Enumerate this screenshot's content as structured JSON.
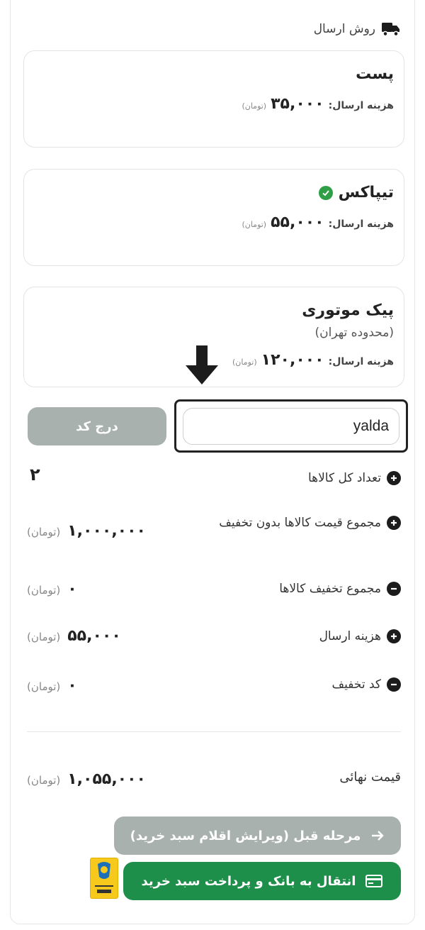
{
  "header": {
    "title": "روش ارسال",
    "icon": "truck-icon"
  },
  "shipping_options": [
    {
      "title": "پست",
      "cost_label": "هزینه ارسال:",
      "cost": "۳۵,۰۰۰",
      "currency": "(تومان)"
    },
    {
      "title": "تیپاکس",
      "cost_label": "هزینه ارسال:",
      "cost": "۵۵,۰۰۰",
      "currency": "(تومان)",
      "selected": true
    },
    {
      "title": "پیک موتوری",
      "subtitle": "(محدوده تهران)",
      "cost_label": "هزینه ارسال:",
      "cost": "۱۲۰,۰۰۰",
      "currency": "(تومان)"
    }
  ],
  "coupon": {
    "value": "yalda",
    "apply_label": "درج کد"
  },
  "summary": {
    "count_label": "تعداد کل کالاها",
    "count_value": "۲",
    "subtotal_label": "مجموع قیمت کالاها بدون تخفیف",
    "subtotal_value": "۱,۰۰۰,۰۰۰",
    "discount_label": "مجموع تخفیف کالاها",
    "discount_value": "۰",
    "shipping_label": "هزینه ارسال",
    "shipping_value": "۵۵,۰۰۰",
    "code_discount_label": "کد تخفیف",
    "code_discount_value": "۰",
    "currency": "(تومان)",
    "final_label": "قیمت نهائی",
    "final_value": "۱,۰۵۵,۰۰۰"
  },
  "actions": {
    "prev_label": "مرحله قبل (ویرایش اقلام سبد خرید)",
    "pay_label": "انتقال به بانک و پرداخت سبد خرید"
  },
  "colors": {
    "green": "#1e8f4a",
    "disabled": "#a8b1ad",
    "check": "#2e9e47",
    "trust_badge": "#f8c91d"
  }
}
